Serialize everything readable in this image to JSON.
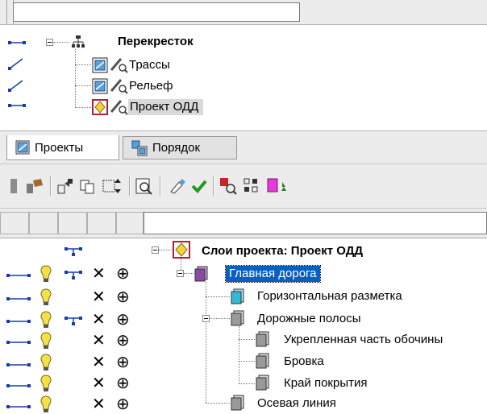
{
  "filter": {
    "value": ""
  },
  "top_tree": {
    "root_label": "Перекресток",
    "items": [
      {
        "label": "Трассы"
      },
      {
        "label": "Рельеф"
      },
      {
        "label": "Проект ОДД"
      }
    ]
  },
  "tabs": [
    {
      "label": "Проекты",
      "active": true
    },
    {
      "label": "Порядок",
      "active": false
    }
  ],
  "toolbar": {
    "buttons": [
      "layer-icon",
      "properties-icon",
      "move-icon",
      "copy-icon",
      "insert-icon",
      "preview-icon",
      "edit-icon",
      "apply-check-icon",
      "filter-icon",
      "grid-select-icon",
      "color-layer-icon"
    ]
  },
  "grid_header": {
    "filter_value": ""
  },
  "layer_tree": {
    "root_label": "Слои проекта: Проект ОДД",
    "selected": "Главная дорога",
    "nodes": [
      {
        "label": "Главная дорога",
        "level": 0
      },
      {
        "label": "Горизонтальная разметка",
        "level": 1
      },
      {
        "label": "Дорожные полосы",
        "level": 1
      },
      {
        "label": "Укрепленная часть обочины",
        "level": 2
      },
      {
        "label": "Бровка",
        "level": 2
      },
      {
        "label": "Край покрытия",
        "level": 2
      },
      {
        "label": "Осевая линия",
        "level": 1
      }
    ]
  },
  "colors": {
    "selection": "#0a5fbf",
    "connector": "#1a3ca8",
    "bulb": "#f3e04a",
    "check": "#1f9a1f"
  }
}
